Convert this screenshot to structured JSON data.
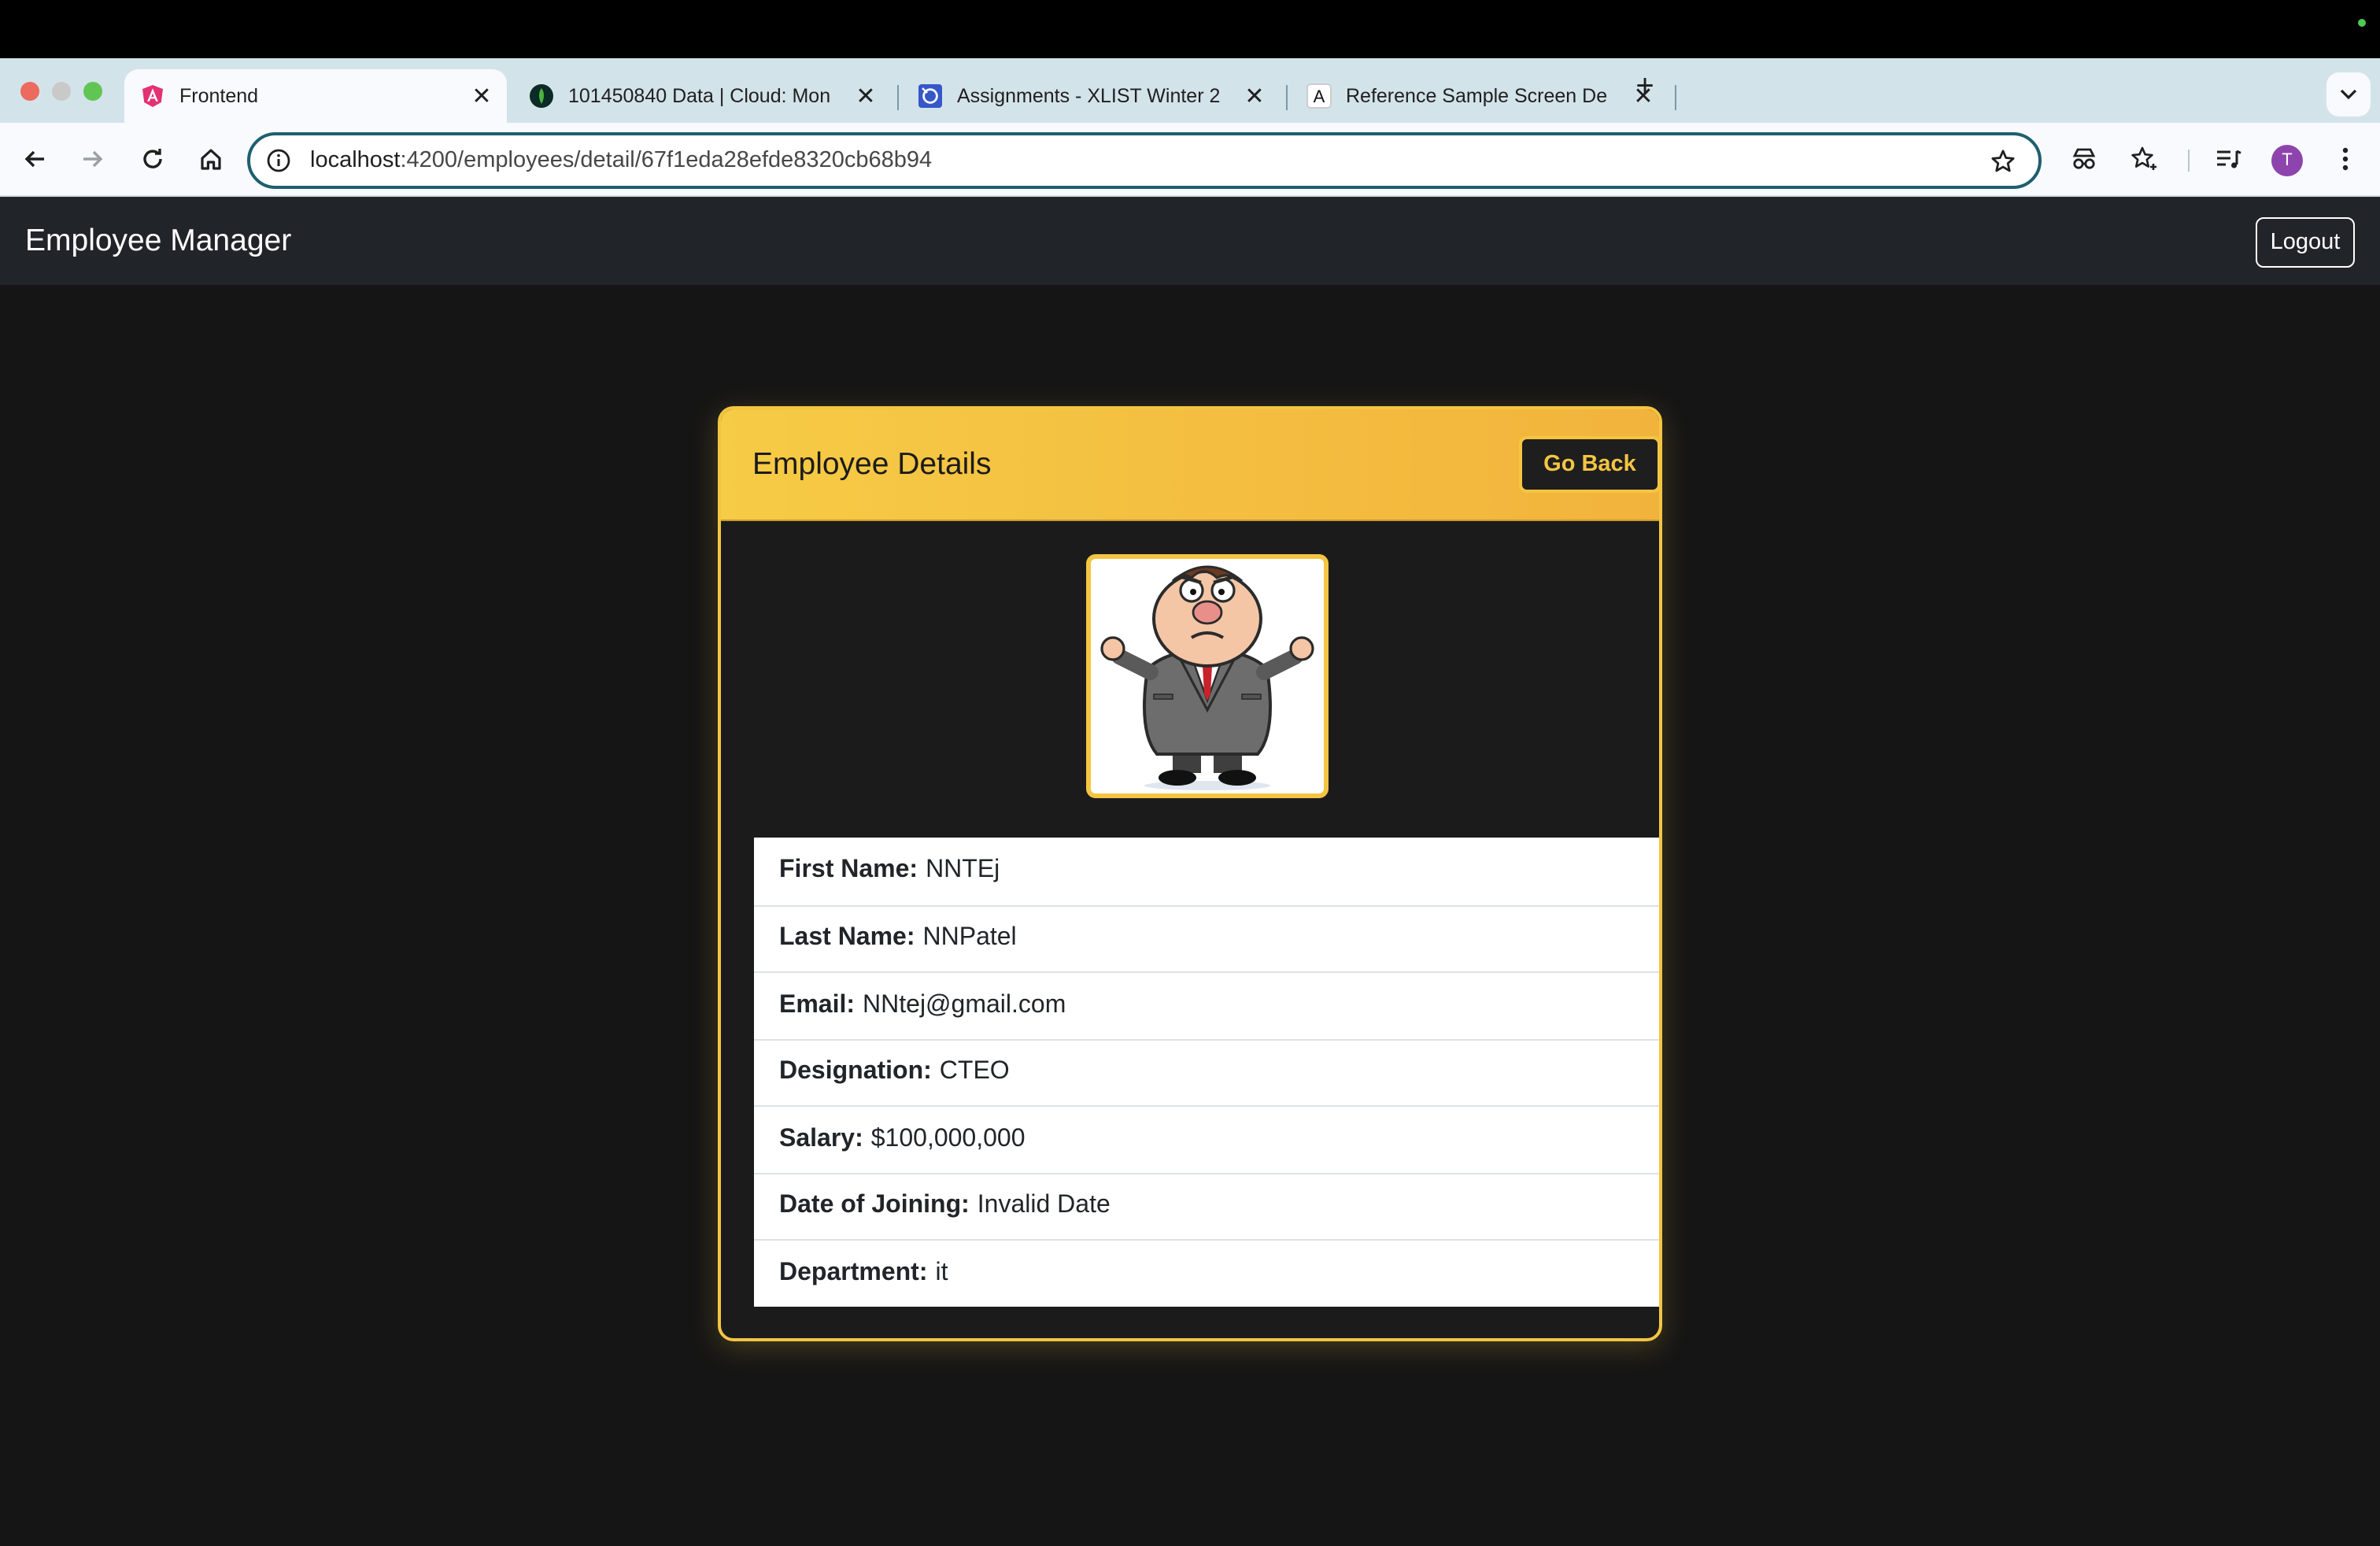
{
  "browser": {
    "tabs": [
      {
        "title": "Frontend",
        "favicon": "angular-icon",
        "active": true
      },
      {
        "title": "101450840 Data | Cloud: Mon",
        "favicon": "mongodb-leaf-icon",
        "active": false
      },
      {
        "title": "Assignments - XLIST Winter 2",
        "favicon": "course-site-icon",
        "active": false
      },
      {
        "title": "Reference Sample Screen De",
        "favicon": "letter-a-icon",
        "active": false
      }
    ],
    "address": {
      "host": "localhost",
      "path": ":4200/employees/detail/67f1eda28efde8320cb68b94"
    },
    "profile_initial": "T"
  },
  "app": {
    "brand": "Employee Manager",
    "logout_label": "Logout"
  },
  "card": {
    "title": "Employee Details",
    "go_back_label": "Go Back",
    "details": [
      {
        "label": "First Name:",
        "value": "NNTEj"
      },
      {
        "label": "Last Name:",
        "value": "NNPatel"
      },
      {
        "label": "Email:",
        "value": "NNtej@gmail.com"
      },
      {
        "label": "Designation:",
        "value": "CTEO"
      },
      {
        "label": "Salary:",
        "value": "$100,000,000"
      },
      {
        "label": "Date of Joining:",
        "value": "Invalid Date"
      },
      {
        "label": "Department:",
        "value": "it"
      }
    ]
  },
  "colors": {
    "accent": "#f4c542",
    "page_bg": "#151515",
    "navbar_bg": "#212529"
  }
}
